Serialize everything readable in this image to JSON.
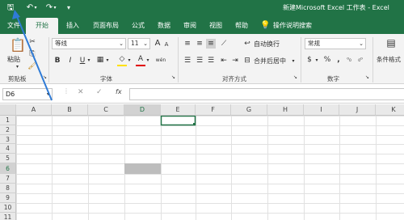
{
  "titlebar": {
    "title": "新建Microsoft Excel 工作表 - Excel",
    "qa": {
      "save": "🖫",
      "undo": "↶",
      "redo": "↷",
      "more": "▾"
    }
  },
  "tabs": [
    "文件",
    "开始",
    "插入",
    "页面布局",
    "公式",
    "数据",
    "审阅",
    "视图",
    "帮助",
    "操作说明搜索"
  ],
  "ribbon": {
    "clipboard": {
      "paste": "粘贴",
      "label": "剪贴板"
    },
    "font": {
      "name": "等线",
      "size": "11",
      "label": "字体",
      "bold": "B",
      "italic": "I",
      "underline": "U",
      "grow": "A",
      "shrink": "A",
      "color_a": "A",
      "wen": "wén"
    },
    "align": {
      "wrap": "自动换行",
      "merge": "合并后居中",
      "label": "对齐方式"
    },
    "number": {
      "format": "常规",
      "label": "数字",
      "currency": "$",
      "percent": "%",
      "comma": ","
    },
    "styles": {
      "cond": "条件格式"
    }
  },
  "formula_bar": {
    "name_box": "D6",
    "cancel": "✕",
    "enter": "✓",
    "fx": "fx",
    "value": ""
  },
  "grid": {
    "columns": [
      "A",
      "B",
      "C",
      "D",
      "E",
      "F",
      "G",
      "H",
      "I",
      "J",
      "K"
    ],
    "rows": [
      "1",
      "2",
      "3",
      "4",
      "5",
      "6",
      "7",
      "8",
      "9",
      "10",
      "11"
    ],
    "active_cell": "E1",
    "selected_cell": "D6"
  },
  "colors": {
    "excel_green": "#217346",
    "ribbon_bg": "#f3f3f3",
    "arrow": "#2f7bd6",
    "selected_fill": "#bdbdbd"
  }
}
